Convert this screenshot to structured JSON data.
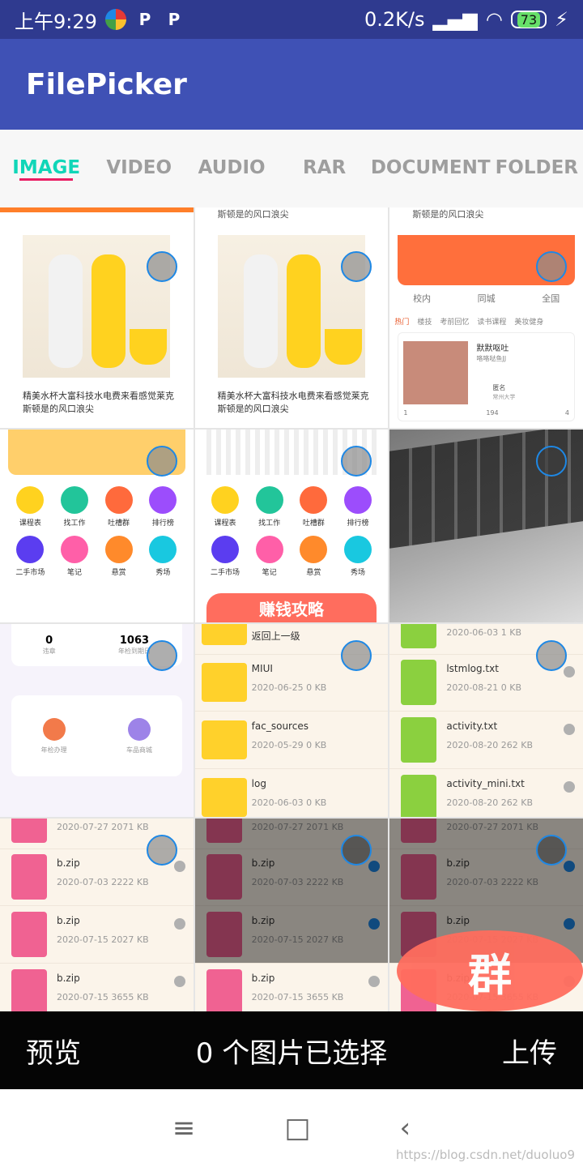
{
  "status_bar": {
    "time": "上午9:29",
    "network": "0.2K/s",
    "battery": "73"
  },
  "app_bar": {
    "title": "FilePicker"
  },
  "tabs": [
    {
      "label": "IMAGE",
      "active": true
    },
    {
      "label": "VIDEO",
      "active": false
    },
    {
      "label": "AUDIO",
      "active": false
    },
    {
      "label": "RAR",
      "active": false
    },
    {
      "label": "DOCUMENT",
      "active": false
    },
    {
      "label": "FOLDER",
      "active": false
    }
  ],
  "grid": {
    "top_strip": [
      "斯顿是的风口浪尖",
      "斯顿是的风口浪尖"
    ],
    "row1": {
      "captions": [
        "精美水杯大富科技水电费来看感觉莱克斯顿是的风口浪尖",
        "精美水杯大富科技水电费来看感觉莱克斯顿是的风口浪尖"
      ],
      "social": {
        "tabs": [
          "校内",
          "同城",
          "全国"
        ],
        "filters": [
          "热门",
          "楼技",
          "考前回忆",
          "读书课程",
          "美妆健身"
        ],
        "post_title": "默默呕吐",
        "post_sub": "咯咯哒鱼JJ",
        "author": "匿名",
        "school": "常州大学",
        "comments": "1",
        "views": "194",
        "likes": "4"
      }
    },
    "row2": {
      "menu": [
        "课程表",
        "找工作",
        "吐槽群",
        "排行榜",
        "二手市场",
        "笔记",
        "悬赏",
        "秀场"
      ],
      "banner": "赚钱攻略"
    },
    "row3": {
      "stats": [
        {
          "value": "0",
          "label": "违章"
        },
        {
          "value": "1063",
          "label": "年检到期日"
        }
      ],
      "actions": [
        "年检办理",
        "车品商城"
      ],
      "folders": [
        {
          "name": "返回上一级",
          "meta": ""
        },
        {
          "name": "MIUI",
          "meta": "2020-06-25  0 KB"
        },
        {
          "name": "fac_sources",
          "meta": "2020-05-29  0 KB"
        },
        {
          "name": "log",
          "meta": "2020-06-03  0 KB"
        }
      ],
      "txts": [
        {
          "name": "",
          "meta": "2020-06-03  1 KB"
        },
        {
          "name": "lstmlog.txt",
          "meta": "2020-08-21  0 KB"
        },
        {
          "name": "activity.txt",
          "meta": "2020-08-20  262 KB"
        },
        {
          "name": "activity_mini.txt",
          "meta": "2020-08-20  262 KB"
        }
      ]
    },
    "row4": {
      "zips": [
        {
          "name": "",
          "meta": "2020-07-27  2071 KB"
        },
        {
          "name": "b.zip",
          "meta": "2020-07-03  2222 KB"
        },
        {
          "name": "b.zip",
          "meta": "2020-07-15  2027 KB"
        },
        {
          "name": "b.zip",
          "meta": "2020-07-15  3655 KB"
        }
      ],
      "badge": "群"
    }
  },
  "bottom_bar": {
    "preview": "预览",
    "selected": "0 个图片已选择",
    "upload": "上传"
  },
  "nav_bar": {
    "menu": "≡",
    "home": "□",
    "back": "‹"
  },
  "watermark": "https://blog.csdn.net/duoluo9",
  "colors": {
    "app_bar": "#3f51b5",
    "active_tab": "#10d6b8",
    "tab_underline": "#e91e63"
  }
}
